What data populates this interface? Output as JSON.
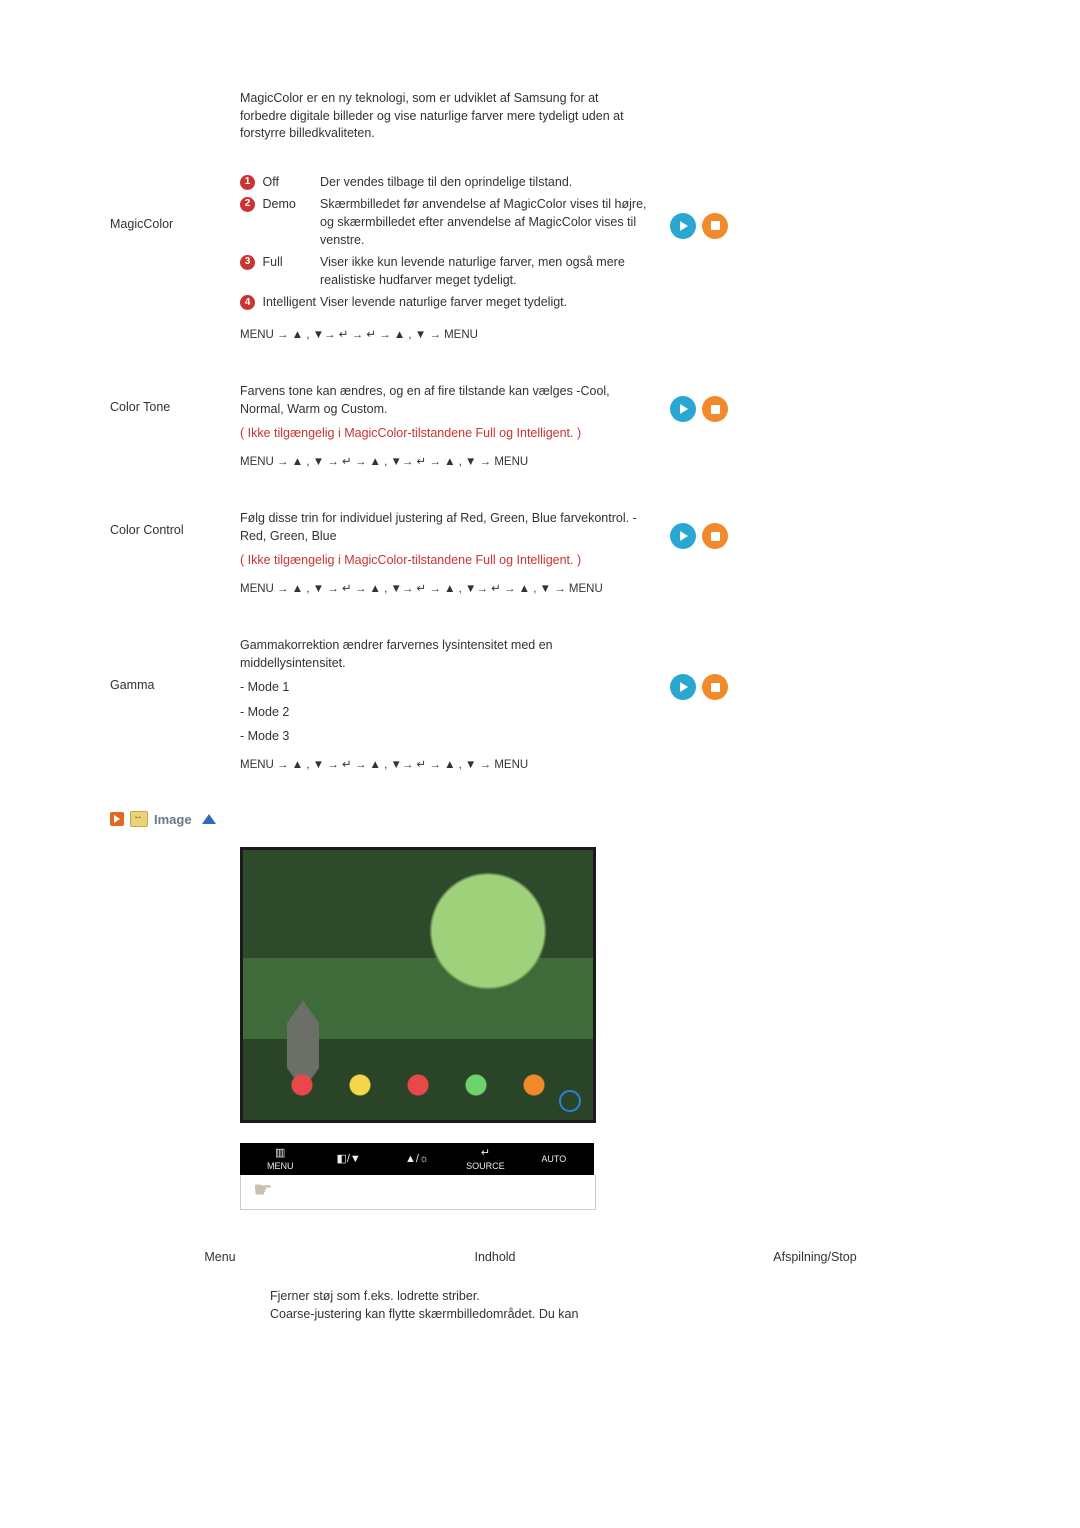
{
  "intro": "MagicColor er en ny teknologi, som er udviklet af Samsung for at forbedre digitale billeder og vise naturlige farver mere tydeligt uden at forstyrre billedkvaliteten.",
  "magiccolor": {
    "label": "MagicColor",
    "options": [
      {
        "n": "1",
        "name": "Off",
        "desc": "Der vendes tilbage til den oprindelige tilstand."
      },
      {
        "n": "2",
        "name": "Demo",
        "desc": "Skærmbilledet før anvendelse af MagicColor vises til højre, og skærmbilledet efter anvendelse af MagicColor vises til venstre."
      },
      {
        "n": "3",
        "name": "Full",
        "desc": "Viser ikke kun levende naturlige farver, men også mere realistiske hudfarver meget tydeligt."
      },
      {
        "n": "4",
        "name": "Intelligent",
        "desc": "Viser levende naturlige farver meget tydeligt."
      }
    ],
    "nav": "MENU → ▲ , ▼→ ↵ → ↵ → ▲ , ▼ → MENU"
  },
  "colortone": {
    "label": "Color Tone",
    "text": "Farvens tone kan ændres, og en af fire tilstande kan vælges   -Cool, Normal, Warm og Custom.",
    "note": "( Ikke tilgængelig i MagicColor-tilstandene Full og Intelligent. )",
    "nav": "MENU → ▲ , ▼ → ↵ → ▲ , ▼→ ↵ → ▲ , ▼ → MENU"
  },
  "colorcontrol": {
    "label": "Color Control",
    "text": "Følg disse trin for individuel justering af Red, Green, Blue farvekontrol. -Red, Green, Blue",
    "note": "( Ikke tilgængelig i MagicColor-tilstandene Full og Intelligent. )",
    "nav": "MENU → ▲ , ▼ → ↵ → ▲ , ▼→ ↵ → ▲ , ▼→ ↵ → ▲ , ▼ → MENU"
  },
  "gamma": {
    "label": "Gamma",
    "text": "Gammakorrektion ændrer farvernes lysintensitet med en middellysintensitet.",
    "modes": [
      "- Mode 1",
      "- Mode 2",
      "- Mode 3"
    ],
    "nav": "MENU → ▲ , ▼ → ↵ → ▲ , ▼→ ↵ → ▲ , ▼ → MENU"
  },
  "section_image": {
    "title": "Image"
  },
  "button_bar": {
    "menu": {
      "glyph": "▥",
      "label": "MENU"
    },
    "adj": {
      "glyph": "◧/▼",
      "label": ""
    },
    "bright": {
      "glyph": "▲/☼",
      "label": ""
    },
    "source": {
      "glyph": "↵",
      "label": "SOURCE"
    },
    "auto": {
      "glyph": "",
      "label": "AUTO"
    }
  },
  "triple": {
    "menu": "Menu",
    "indhold": "Indhold",
    "afspil": "Afspilning/Stop"
  },
  "bottom": {
    "line1": "Fjerner støj som f.eks. lodrette striber.",
    "line2": "Coarse-justering kan flytte skærmbilledområdet. Du kan"
  }
}
